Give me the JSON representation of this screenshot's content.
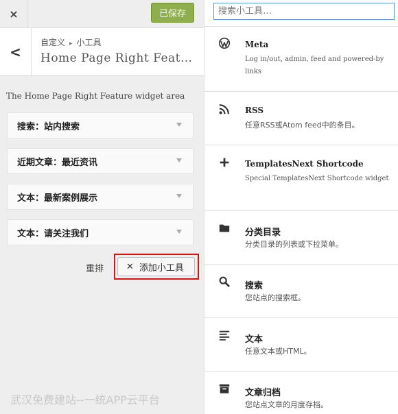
{
  "topbar": {
    "close_icon": "×",
    "saved_label": "已保存"
  },
  "header": {
    "breadcrumb_root": "自定义",
    "breadcrumb_sep": "▸",
    "breadcrumb_current": "小工具",
    "back_icon": "<",
    "title": "Home Page Right Feat…"
  },
  "area_description": "The Home Page Right Feature widget area",
  "widgets": [
    {
      "label": "搜索：站内搜索"
    },
    {
      "label": "近期文章：最近资讯"
    },
    {
      "label": "文本：最新案例展示"
    },
    {
      "label": "文本：请关注我们"
    }
  ],
  "actions": {
    "reorder_label": "重排",
    "add_label": "添加小工具",
    "add_icon": "✕"
  },
  "watermark": "武汉免费建站--一统APP云平台",
  "search": {
    "placeholder": "搜索小工具…"
  },
  "available_widgets": [
    {
      "icon": "wordpress-icon",
      "title": "Meta",
      "desc": "Log in/out, admin, feed and powered-by links"
    },
    {
      "icon": "rss-icon",
      "title": "RSS",
      "desc": "任意RSS或Atom feed中的条目。"
    },
    {
      "icon": "plus-icon",
      "title": "TemplatesNext Shortcode",
      "desc": "Special TemplatesNext Shortcode widget"
    },
    {
      "icon": "folder-icon",
      "title": "分类目录",
      "desc": "分类目录的列表或下拉菜单。"
    },
    {
      "icon": "search-icon",
      "title": "搜索",
      "desc": "您站点的搜索框。"
    },
    {
      "icon": "text-icon",
      "title": "文本",
      "desc": "任意文本或HTML。"
    },
    {
      "icon": "archive-icon",
      "title": "文章归档",
      "desc": "您站点文章的月度存档。"
    }
  ],
  "colors": {
    "saved_button": "#8faf4e",
    "highlight_border": "#e01010",
    "search_border": "#5b9dd9"
  }
}
